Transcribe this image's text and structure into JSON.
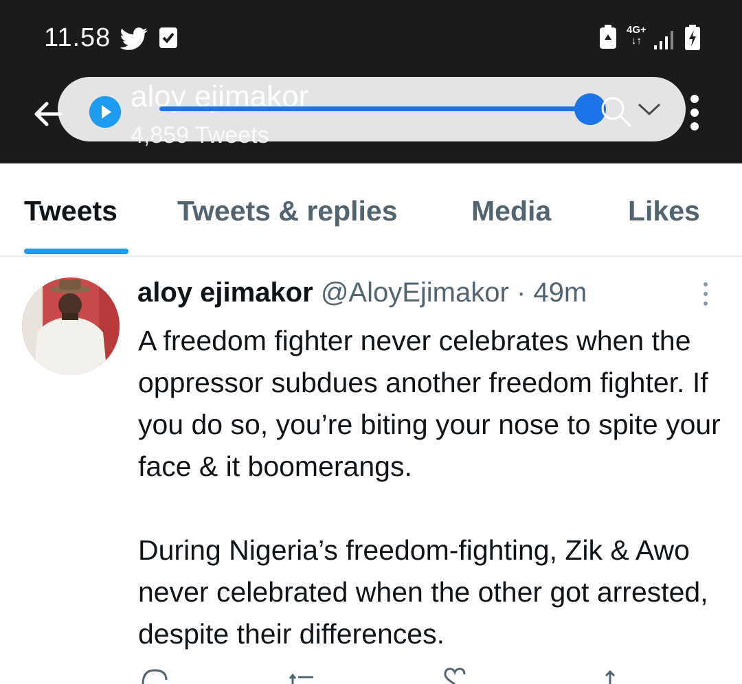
{
  "status_bar": {
    "time": "11.58",
    "network_type": "4G+",
    "icons": [
      "twitter-icon",
      "checkbox-icon",
      "battery-saver-icon",
      "data-arrows-icon",
      "signal-icon",
      "battery-charging-icon"
    ]
  },
  "header": {
    "profile_name": "aloy ejimakor",
    "tweet_count": "4,859 Tweets",
    "icons": [
      "back-arrow-icon",
      "play-icon",
      "search-icon",
      "chevron-down-icon",
      "more-vertical-icon"
    ]
  },
  "tabs": [
    {
      "label": "Tweets",
      "active": true
    },
    {
      "label": "Tweets & replies",
      "active": false
    },
    {
      "label": "Media",
      "active": false
    },
    {
      "label": "Likes",
      "active": false
    }
  ],
  "tweet": {
    "author_name": "aloy ejimakor",
    "handle": "@AloyEjimakor",
    "separator": "·",
    "time": "49m",
    "paragraphs": [
      "A freedom fighter never celebrates when the oppressor subdues another freedom fighter. If you do so, you’re biting your nose to spite your face & it boomerangs.",
      "During Nigeria’s freedom-fighting, Zik & Awo never celebrated when the other got arrested, despite their differences."
    ]
  },
  "colors": {
    "accent": "#1d9bf0",
    "dark_bar": "#1c1a1a",
    "text_primary": "#0f1419",
    "text_secondary": "#536471"
  }
}
